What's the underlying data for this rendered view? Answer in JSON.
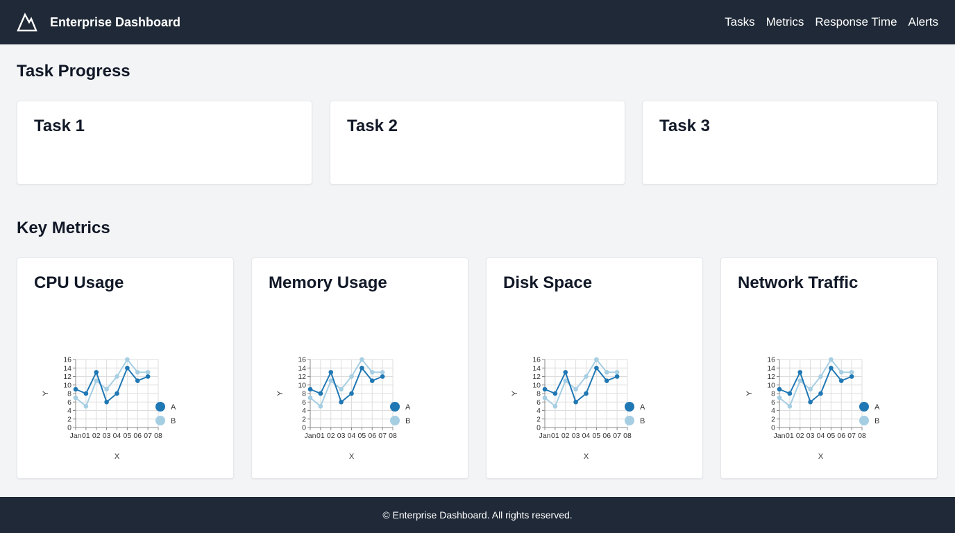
{
  "header": {
    "title": "Enterprise Dashboard",
    "nav": [
      "Tasks",
      "Metrics",
      "Response Time",
      "Alerts"
    ]
  },
  "task_progress": {
    "title": "Task Progress",
    "tasks": [
      "Task 1",
      "Task 2",
      "Task 3"
    ]
  },
  "key_metrics": {
    "title": "Key Metrics",
    "cards": [
      "CPU Usage",
      "Memory Usage",
      "Disk Space",
      "Network Traffic"
    ]
  },
  "footer": {
    "text": "© Enterprise Dashboard. All rights reserved."
  },
  "colors": {
    "header_bg": "#1f2937",
    "series_a": "#1f77b4",
    "series_b": "#a6cee3"
  },
  "chart_data": [
    {
      "type": "line",
      "x": [
        "Jan",
        "01",
        "02",
        "03",
        "04",
        "05",
        "06",
        "07",
        "08"
      ],
      "series": [
        {
          "name": "A",
          "values": [
            9,
            8,
            13,
            6,
            8,
            14,
            11,
            12
          ]
        },
        {
          "name": "B",
          "values": [
            7,
            5,
            11,
            9,
            12,
            16,
            13,
            13
          ]
        }
      ],
      "xlabel": "X",
      "ylabel": "Y",
      "ylim": [
        0,
        16
      ],
      "yticks": [
        0,
        2,
        4,
        6,
        8,
        10,
        12,
        14,
        16
      ],
      "grid": true,
      "legend": "right"
    },
    {
      "type": "line",
      "x": [
        "Jan",
        "01",
        "02",
        "03",
        "04",
        "05",
        "06",
        "07",
        "08"
      ],
      "series": [
        {
          "name": "A",
          "values": [
            9,
            8,
            13,
            6,
            8,
            14,
            11,
            12
          ]
        },
        {
          "name": "B",
          "values": [
            7,
            5,
            11,
            9,
            12,
            16,
            13,
            13
          ]
        }
      ],
      "xlabel": "X",
      "ylabel": "Y",
      "ylim": [
        0,
        16
      ],
      "yticks": [
        0,
        2,
        4,
        6,
        8,
        10,
        12,
        14,
        16
      ],
      "grid": true,
      "legend": "right"
    },
    {
      "type": "line",
      "x": [
        "Jan",
        "01",
        "02",
        "03",
        "04",
        "05",
        "06",
        "07",
        "08"
      ],
      "series": [
        {
          "name": "A",
          "values": [
            9,
            8,
            13,
            6,
            8,
            14,
            11,
            12
          ]
        },
        {
          "name": "B",
          "values": [
            7,
            5,
            11,
            9,
            12,
            16,
            13,
            13
          ]
        }
      ],
      "xlabel": "X",
      "ylabel": "Y",
      "ylim": [
        0,
        16
      ],
      "yticks": [
        0,
        2,
        4,
        6,
        8,
        10,
        12,
        14,
        16
      ],
      "grid": true,
      "legend": "right"
    },
    {
      "type": "line",
      "x": [
        "Jan",
        "01",
        "02",
        "03",
        "04",
        "05",
        "06",
        "07",
        "08"
      ],
      "series": [
        {
          "name": "A",
          "values": [
            9,
            8,
            13,
            6,
            8,
            14,
            11,
            12
          ]
        },
        {
          "name": "B",
          "values": [
            7,
            5,
            11,
            9,
            12,
            16,
            13,
            13
          ]
        }
      ],
      "xlabel": "X",
      "ylabel": "Y",
      "ylim": [
        0,
        16
      ],
      "yticks": [
        0,
        2,
        4,
        6,
        8,
        10,
        12,
        14,
        16
      ],
      "grid": true,
      "legend": "right"
    }
  ]
}
